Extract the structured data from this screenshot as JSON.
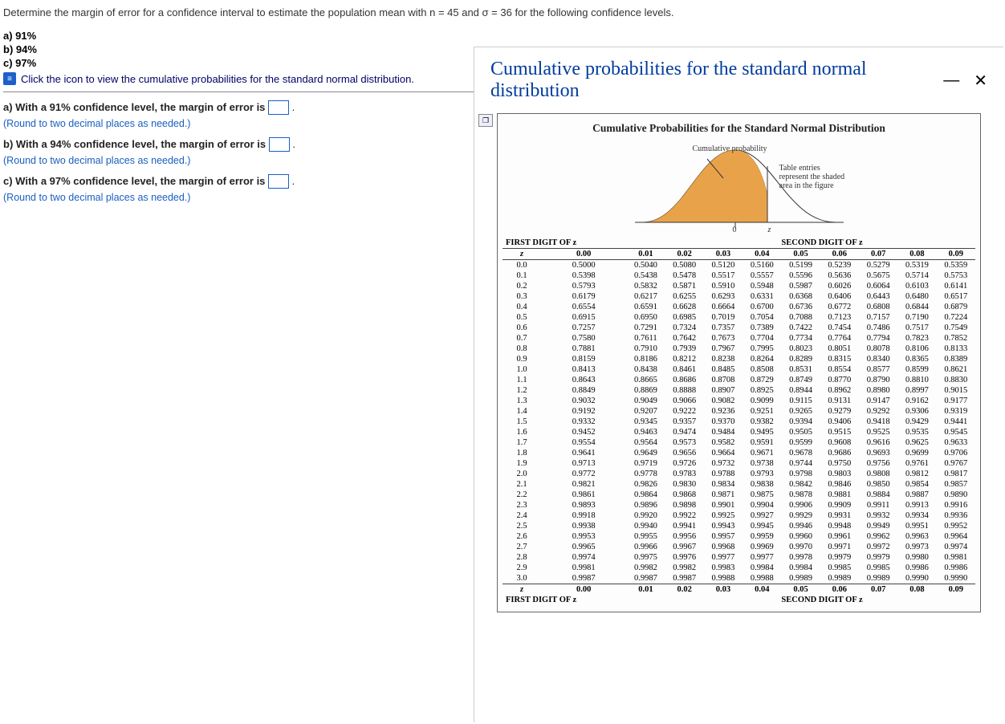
{
  "question": {
    "prompt": "Determine the margin of error for a confidence interval to estimate the population mean with n = 45 and σ = 36 for the following confidence levels.",
    "options": {
      "a": "a) 91%",
      "b": "b) 94%",
      "c": "c) 97%"
    },
    "icon_note": "Click the icon to view the cumulative probabilities for the standard normal distribution."
  },
  "answers": {
    "a_pre": "a) With a 91% confidence level, the margin of error is ",
    "b_pre": "b) With a 94% confidence level, the margin of error is ",
    "c_pre": "c) With a 97% confidence level, the margin of error is ",
    "period": ".",
    "round": "(Round to two decimal places as needed.)"
  },
  "overlay": {
    "title": "Cumulative probabilities for the standard normal distribution",
    "caption": "Cumulative Probabilities for the Standard Normal Distribution",
    "bell": {
      "cum_label": "Cumulative probability",
      "table_label": "Table entries represent the shaded area in the figure",
      "zero": "0",
      "z": "z"
    },
    "header_first": "FIRST DIGIT OF z",
    "header_second": "SECOND DIGIT OF z",
    "z_label": "z",
    "col_headers": [
      "0.00",
      "0.01",
      "0.02",
      "0.03",
      "0.04",
      "0.05",
      "0.06",
      "0.07",
      "0.08",
      "0.09"
    ]
  },
  "chart_data": {
    "type": "table",
    "title": "Cumulative Probabilities for the Standard Normal Distribution",
    "columns": [
      "z",
      "0.00",
      "0.01",
      "0.02",
      "0.03",
      "0.04",
      "0.05",
      "0.06",
      "0.07",
      "0.08",
      "0.09"
    ],
    "rows": [
      [
        "0.0",
        "0.5000",
        "0.5040",
        "0.5080",
        "0.5120",
        "0.5160",
        "0.5199",
        "0.5239",
        "0.5279",
        "0.5319",
        "0.5359"
      ],
      [
        "0.1",
        "0.5398",
        "0.5438",
        "0.5478",
        "0.5517",
        "0.5557",
        "0.5596",
        "0.5636",
        "0.5675",
        "0.5714",
        "0.5753"
      ],
      [
        "0.2",
        "0.5793",
        "0.5832",
        "0.5871",
        "0.5910",
        "0.5948",
        "0.5987",
        "0.6026",
        "0.6064",
        "0.6103",
        "0.6141"
      ],
      [
        "0.3",
        "0.6179",
        "0.6217",
        "0.6255",
        "0.6293",
        "0.6331",
        "0.6368",
        "0.6406",
        "0.6443",
        "0.6480",
        "0.6517"
      ],
      [
        "0.4",
        "0.6554",
        "0.6591",
        "0.6628",
        "0.6664",
        "0.6700",
        "0.6736",
        "0.6772",
        "0.6808",
        "0.6844",
        "0.6879"
      ],
      [
        "0.5",
        "0.6915",
        "0.6950",
        "0.6985",
        "0.7019",
        "0.7054",
        "0.7088",
        "0.7123",
        "0.7157",
        "0.7190",
        "0.7224"
      ],
      [
        "0.6",
        "0.7257",
        "0.7291",
        "0.7324",
        "0.7357",
        "0.7389",
        "0.7422",
        "0.7454",
        "0.7486",
        "0.7517",
        "0.7549"
      ],
      [
        "0.7",
        "0.7580",
        "0.7611",
        "0.7642",
        "0.7673",
        "0.7704",
        "0.7734",
        "0.7764",
        "0.7794",
        "0.7823",
        "0.7852"
      ],
      [
        "0.8",
        "0.7881",
        "0.7910",
        "0.7939",
        "0.7967",
        "0.7995",
        "0.8023",
        "0.8051",
        "0.8078",
        "0.8106",
        "0.8133"
      ],
      [
        "0.9",
        "0.8159",
        "0.8186",
        "0.8212",
        "0.8238",
        "0.8264",
        "0.8289",
        "0.8315",
        "0.8340",
        "0.8365",
        "0.8389"
      ],
      [
        "1.0",
        "0.8413",
        "0.8438",
        "0.8461",
        "0.8485",
        "0.8508",
        "0.8531",
        "0.8554",
        "0.8577",
        "0.8599",
        "0.8621"
      ],
      [
        "1.1",
        "0.8643",
        "0.8665",
        "0.8686",
        "0.8708",
        "0.8729",
        "0.8749",
        "0.8770",
        "0.8790",
        "0.8810",
        "0.8830"
      ],
      [
        "1.2",
        "0.8849",
        "0.8869",
        "0.8888",
        "0.8907",
        "0.8925",
        "0.8944",
        "0.8962",
        "0.8980",
        "0.8997",
        "0.9015"
      ],
      [
        "1.3",
        "0.9032",
        "0.9049",
        "0.9066",
        "0.9082",
        "0.9099",
        "0.9115",
        "0.9131",
        "0.9147",
        "0.9162",
        "0.9177"
      ],
      [
        "1.4",
        "0.9192",
        "0.9207",
        "0.9222",
        "0.9236",
        "0.9251",
        "0.9265",
        "0.9279",
        "0.9292",
        "0.9306",
        "0.9319"
      ],
      [
        "1.5",
        "0.9332",
        "0.9345",
        "0.9357",
        "0.9370",
        "0.9382",
        "0.9394",
        "0.9406",
        "0.9418",
        "0.9429",
        "0.9441"
      ],
      [
        "1.6",
        "0.9452",
        "0.9463",
        "0.9474",
        "0.9484",
        "0.9495",
        "0.9505",
        "0.9515",
        "0.9525",
        "0.9535",
        "0.9545"
      ],
      [
        "1.7",
        "0.9554",
        "0.9564",
        "0.9573",
        "0.9582",
        "0.9591",
        "0.9599",
        "0.9608",
        "0.9616",
        "0.9625",
        "0.9633"
      ],
      [
        "1.8",
        "0.9641",
        "0.9649",
        "0.9656",
        "0.9664",
        "0.9671",
        "0.9678",
        "0.9686",
        "0.9693",
        "0.9699",
        "0.9706"
      ],
      [
        "1.9",
        "0.9713",
        "0.9719",
        "0.9726",
        "0.9732",
        "0.9738",
        "0.9744",
        "0.9750",
        "0.9756",
        "0.9761",
        "0.9767"
      ],
      [
        "2.0",
        "0.9772",
        "0.9778",
        "0.9783",
        "0.9788",
        "0.9793",
        "0.9798",
        "0.9803",
        "0.9808",
        "0.9812",
        "0.9817"
      ],
      [
        "2.1",
        "0.9821",
        "0.9826",
        "0.9830",
        "0.9834",
        "0.9838",
        "0.9842",
        "0.9846",
        "0.9850",
        "0.9854",
        "0.9857"
      ],
      [
        "2.2",
        "0.9861",
        "0.9864",
        "0.9868",
        "0.9871",
        "0.9875",
        "0.9878",
        "0.9881",
        "0.9884",
        "0.9887",
        "0.9890"
      ],
      [
        "2.3",
        "0.9893",
        "0.9896",
        "0.9898",
        "0.9901",
        "0.9904",
        "0.9906",
        "0.9909",
        "0.9911",
        "0.9913",
        "0.9916"
      ],
      [
        "2.4",
        "0.9918",
        "0.9920",
        "0.9922",
        "0.9925",
        "0.9927",
        "0.9929",
        "0.9931",
        "0.9932",
        "0.9934",
        "0.9936"
      ],
      [
        "2.5",
        "0.9938",
        "0.9940",
        "0.9941",
        "0.9943",
        "0.9945",
        "0.9946",
        "0.9948",
        "0.9949",
        "0.9951",
        "0.9952"
      ],
      [
        "2.6",
        "0.9953",
        "0.9955",
        "0.9956",
        "0.9957",
        "0.9959",
        "0.9960",
        "0.9961",
        "0.9962",
        "0.9963",
        "0.9964"
      ],
      [
        "2.7",
        "0.9965",
        "0.9966",
        "0.9967",
        "0.9968",
        "0.9969",
        "0.9970",
        "0.9971",
        "0.9972",
        "0.9973",
        "0.9974"
      ],
      [
        "2.8",
        "0.9974",
        "0.9975",
        "0.9976",
        "0.9977",
        "0.9977",
        "0.9978",
        "0.9979",
        "0.9979",
        "0.9980",
        "0.9981"
      ],
      [
        "2.9",
        "0.9981",
        "0.9982",
        "0.9982",
        "0.9983",
        "0.9984",
        "0.9984",
        "0.9985",
        "0.9985",
        "0.9986",
        "0.9986"
      ],
      [
        "3.0",
        "0.9987",
        "0.9987",
        "0.9987",
        "0.9988",
        "0.9988",
        "0.9989",
        "0.9989",
        "0.9989",
        "0.9990",
        "0.9990"
      ]
    ]
  }
}
